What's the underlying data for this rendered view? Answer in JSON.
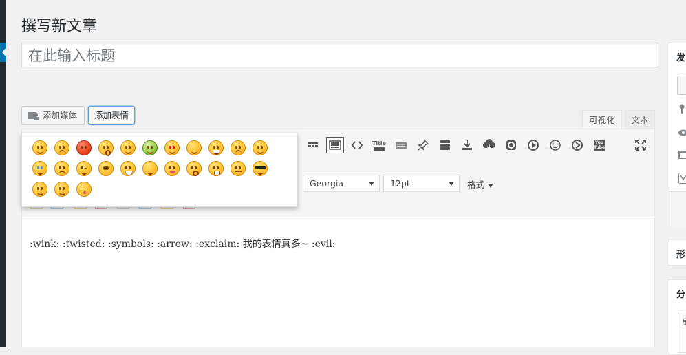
{
  "page": {
    "title": "撰写新文章"
  },
  "post": {
    "title_placeholder": "在此输入标题",
    "content": ":wink: :twisted: :symbols: :arrow: :exclaim: 我的表情真多~ :evil:"
  },
  "buttons": {
    "add_media": "添加媒体",
    "add_emoji": "添加表情"
  },
  "tabs": {
    "visual": "可视化",
    "text": "文本"
  },
  "toolbar": {
    "icons": [
      "horizontal-rule-icon",
      "keyboard-icon",
      "code-icon",
      "title-icon",
      "keyboard-small-icon",
      "pin-icon",
      "layers-icon",
      "download-icon",
      "cloud-download-icon",
      "record-icon",
      "play-icon",
      "smile-icon",
      "next-icon",
      "youtube-icon",
      "fullscreen-icon"
    ],
    "title_icon_text": "Title",
    "youtube_icon_text": "You Tube",
    "font_family": "Georgia",
    "font_size": "12pt",
    "format_label": "格式"
  },
  "emoji_panel": {
    "rows": [
      [
        "smile",
        "angry",
        "red",
        "surprised",
        "happy",
        "sick",
        "love",
        "grin",
        "laugh",
        "sad",
        "smile2"
      ],
      [
        "cry",
        "frown",
        "wink",
        "shock",
        "mask",
        "content",
        "tongue",
        "surprise2",
        "scream",
        "annoyed",
        "cool"
      ],
      [
        "blush",
        "shy",
        "kiss"
      ]
    ]
  },
  "sidebar": {
    "publish_heading": "发",
    "format_heading": "形",
    "category_heading": "分",
    "category_item": "扉"
  },
  "colors": {
    "accent": "#0073aa",
    "admin_bar": "#23282d",
    "focus": "#5b9dd9"
  }
}
